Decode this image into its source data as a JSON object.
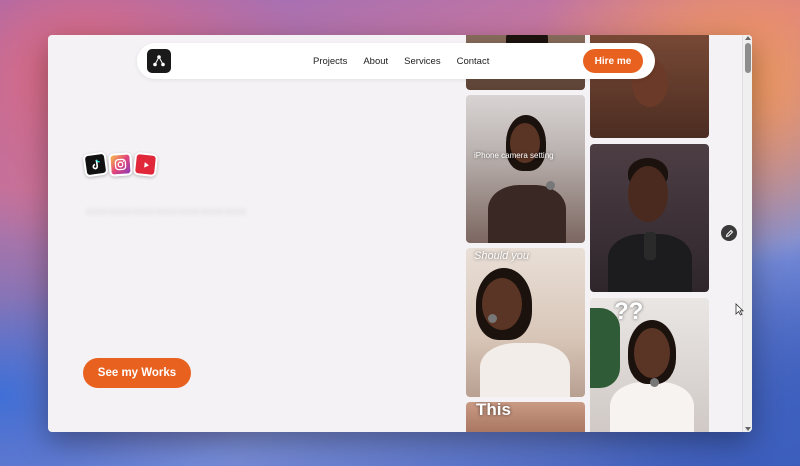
{
  "nav": {
    "logo_icon": "triangle-dots-icon",
    "links": [
      "Projects",
      "About",
      "Services",
      "Contact"
    ],
    "hire_label": "Hire me"
  },
  "hero": {
    "social_icons": [
      "tiktok-icon",
      "instagram-icon",
      "youtube-icon"
    ],
    "cta_label": "See my Works"
  },
  "gallery": {
    "thumb_texts": {
      "iphone": "iPhone camera setting",
      "should": "Should you",
      "question": "??",
      "this": "This"
    }
  },
  "colors": {
    "accent": "#e8611f",
    "page_bg": "#f4f2f5"
  }
}
